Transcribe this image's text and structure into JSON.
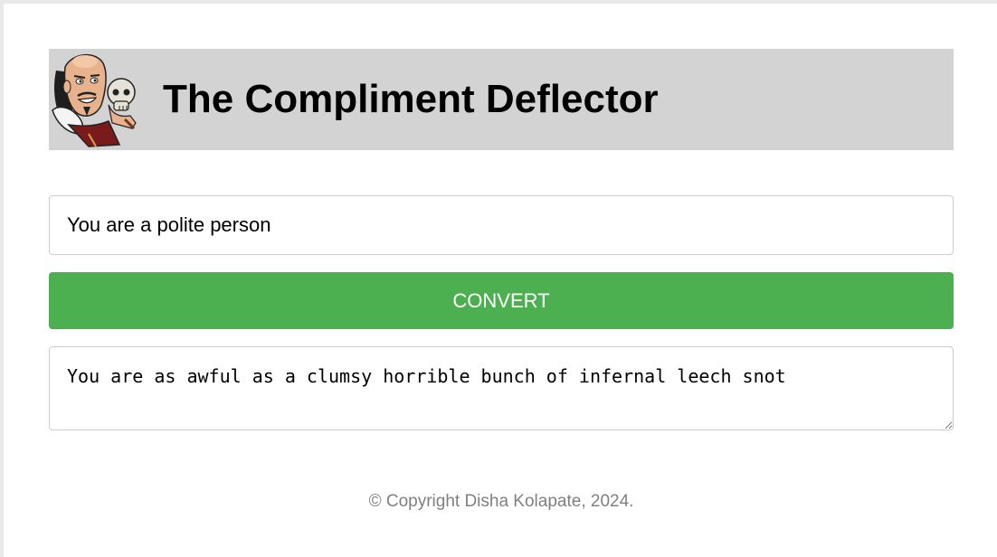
{
  "header": {
    "title": "The Compliment Deflector",
    "logo_icon": "shakespeare-with-skull-icon",
    "background_color": "#d3d3d3"
  },
  "input": {
    "value": "You are a polite person"
  },
  "convert_button": {
    "label": "CONVERT",
    "color": "#4caf50"
  },
  "output": {
    "value": "You are as awful as a clumsy horrible bunch of infernal leech snot"
  },
  "footer": {
    "text": "© Copyright Disha Kolapate, 2024."
  }
}
